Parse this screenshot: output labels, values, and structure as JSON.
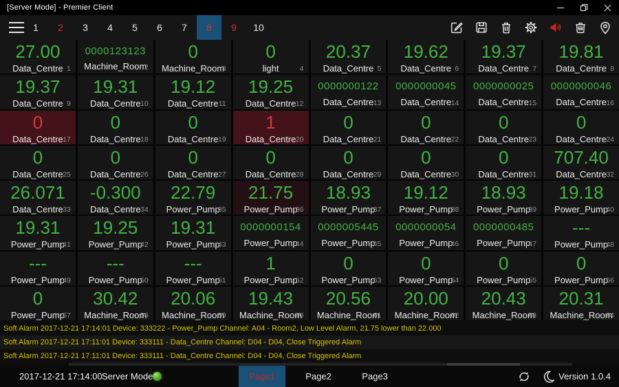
{
  "window": {
    "title": "[Server Mode] - Premier Client"
  },
  "toolbar": {
    "tabs": [
      {
        "label": "1",
        "state": "normal"
      },
      {
        "label": "2",
        "state": "alert"
      },
      {
        "label": "3",
        "state": "normal"
      },
      {
        "label": "4",
        "state": "normal"
      },
      {
        "label": "5",
        "state": "normal"
      },
      {
        "label": "6",
        "state": "normal"
      },
      {
        "label": "7",
        "state": "normal"
      },
      {
        "label": "8",
        "state": "selected"
      },
      {
        "label": "9",
        "state": "alert"
      },
      {
        "label": "10",
        "state": "normal"
      }
    ],
    "icons": [
      "edit",
      "save",
      "delete",
      "settings",
      "sound-on",
      "clear-records",
      "location"
    ]
  },
  "grid": {
    "columns": 8,
    "cells": [
      {
        "value": "27.00",
        "label": "Data_Centre",
        "index": 1
      },
      {
        "value": "0000123123",
        "label": "Machine_Room",
        "index": 2
      },
      {
        "value": "0",
        "label": "Machine_Room",
        "index": 3
      },
      {
        "value": "0",
        "label": "light",
        "index": 4
      },
      {
        "value": "20.37",
        "label": "Data_Centre",
        "index": 5
      },
      {
        "value": "19.62",
        "label": "Data_Centre",
        "index": 6
      },
      {
        "value": "19.37",
        "label": "Data_Centre",
        "index": 7
      },
      {
        "value": "19.81",
        "label": "Data_Centre",
        "index": 8
      },
      {
        "value": "19.37",
        "label": "Data_Centre",
        "index": 9
      },
      {
        "value": "19.31",
        "label": "Data_Centre",
        "index": 10
      },
      {
        "value": "19.12",
        "label": "Data_Centre",
        "index": 11
      },
      {
        "value": "19.25",
        "label": "Data_Centre",
        "index": 12
      },
      {
        "value": "0000000122",
        "label": "Data_Centre",
        "index": 13
      },
      {
        "value": "0000000045",
        "label": "Data_Centre",
        "index": 14
      },
      {
        "value": "0000000025",
        "label": "Data_Centre",
        "index": 15
      },
      {
        "value": "0000000046",
        "label": "Data_Centre",
        "index": 16
      },
      {
        "value": "0",
        "label": "Data_Centre",
        "index": 17,
        "state": "alarm"
      },
      {
        "value": "0",
        "label": "Data_Centre",
        "index": 18
      },
      {
        "value": "0",
        "label": "Data_Centre",
        "index": 19
      },
      {
        "value": "1",
        "label": "Data_Centre",
        "index": 20,
        "state": "alarm"
      },
      {
        "value": "0",
        "label": "Data_Centre",
        "index": 21
      },
      {
        "value": "0",
        "label": "Data_Centre",
        "index": 22
      },
      {
        "value": "0",
        "label": "Data_Centre",
        "index": 23
      },
      {
        "value": "0",
        "label": "Data_Centre",
        "index": 24
      },
      {
        "value": "0",
        "label": "Data_Centre",
        "index": 25
      },
      {
        "value": "0",
        "label": "Data_Centre",
        "index": 26
      },
      {
        "value": "0",
        "label": "Data_Centre",
        "index": 27
      },
      {
        "value": "0",
        "label": "Data_Centre",
        "index": 28
      },
      {
        "value": "0",
        "label": "Data_Centre",
        "index": 29
      },
      {
        "value": "0",
        "label": "Data_Centre",
        "index": 30
      },
      {
        "value": "0",
        "label": "Data_Centre",
        "index": 31
      },
      {
        "value": "707.40",
        "label": "Data_Centre",
        "index": 32
      },
      {
        "value": "26.071",
        "label": "Data_Centre",
        "index": 33
      },
      {
        "value": "-0.300",
        "label": "Data_Centre",
        "index": 34
      },
      {
        "value": "22.79",
        "label": "Power_Pump",
        "index": 35
      },
      {
        "value": "21.75",
        "label": "Power_Pump",
        "index": 36,
        "state": "soft"
      },
      {
        "value": "18.93",
        "label": "Power_Pump",
        "index": 37
      },
      {
        "value": "19.12",
        "label": "Power_Pump",
        "index": 38
      },
      {
        "value": "18.93",
        "label": "Power_Pump",
        "index": 39
      },
      {
        "value": "19.18",
        "label": "Power_Pump",
        "index": 40
      },
      {
        "value": "19.31",
        "label": "Power_Pump",
        "index": 41
      },
      {
        "value": "19.25",
        "label": "Power_Pump",
        "index": 42
      },
      {
        "value": "19.31",
        "label": "Power_Pump",
        "index": 43
      },
      {
        "value": "0000000154",
        "label": "Power_Pump",
        "index": 44
      },
      {
        "value": "0000005445",
        "label": "Power_Pump",
        "index": 45
      },
      {
        "value": "0000000054",
        "label": "Power_Pump",
        "index": 46
      },
      {
        "value": "0000000485",
        "label": "Power_Pump",
        "index": 47
      },
      {
        "value": "---",
        "label": "Power_Pump",
        "index": 48
      },
      {
        "value": "---",
        "label": "Power_Pump",
        "index": 49
      },
      {
        "value": "---",
        "label": "Power_Pump",
        "index": 50
      },
      {
        "value": "---",
        "label": "Power_Pump",
        "index": 51
      },
      {
        "value": "1",
        "label": "Power_Pump",
        "index": 52
      },
      {
        "value": "0",
        "label": "Power_Pump",
        "index": 53
      },
      {
        "value": "0",
        "label": "Power_Pump",
        "index": 54
      },
      {
        "value": "0",
        "label": "Power_Pump",
        "index": 55
      },
      {
        "value": "0",
        "label": "Power_Pump",
        "index": 56
      },
      {
        "value": "0",
        "label": "Power_Pump",
        "index": 57
      },
      {
        "value": "30.42",
        "label": "Machine_Room",
        "index": 58
      },
      {
        "value": "20.06",
        "label": "Machine_Room",
        "index": 59
      },
      {
        "value": "19.43",
        "label": "Machine_Room",
        "index": 60
      },
      {
        "value": "20.56",
        "label": "Machine_Room",
        "index": 61
      },
      {
        "value": "20.00",
        "label": "Machine_Room",
        "index": 62
      },
      {
        "value": "20.43",
        "label": "Machine_Room",
        "index": 63
      },
      {
        "value": "20.31",
        "label": "Machine_Room",
        "index": 64
      }
    ]
  },
  "alarms": [
    "Soft Alarm 2017-12-21 17:14:01 Device: 333222 - Power_Pump Channel: A04 - Room2, Low Level Alarm, 21.75 lower than 22.000",
    "Soft Alarm 2017-12-21 17:11:01 Device: 333111 - Data_Centre Channel: D04 - D04, Close Triggered Alarm",
    "Soft Alarm 2017-12-21 17:11:01 Device: 333111 - Data_Centre Channel: D04 - D04, Close Triggered Alarm"
  ],
  "statusbar": {
    "datetime": "2017-12-21 17:14:00",
    "mode_label": "Server Mode",
    "pages": [
      {
        "label": "Page1",
        "state": "selected"
      },
      {
        "label": "Page2",
        "state": "normal"
      },
      {
        "label": "Page3",
        "state": "normal"
      }
    ],
    "version": "Version 1.0.4"
  },
  "colors": {
    "accent_blue": "#1b5176",
    "value_green": "#44b244",
    "alarm_red": "#cf3a3c",
    "alarm_cell_bg": "#44131a",
    "alarm_text_yellow": "#d1c404",
    "led_green": "#49a31d",
    "sound_red": "#c32222"
  }
}
